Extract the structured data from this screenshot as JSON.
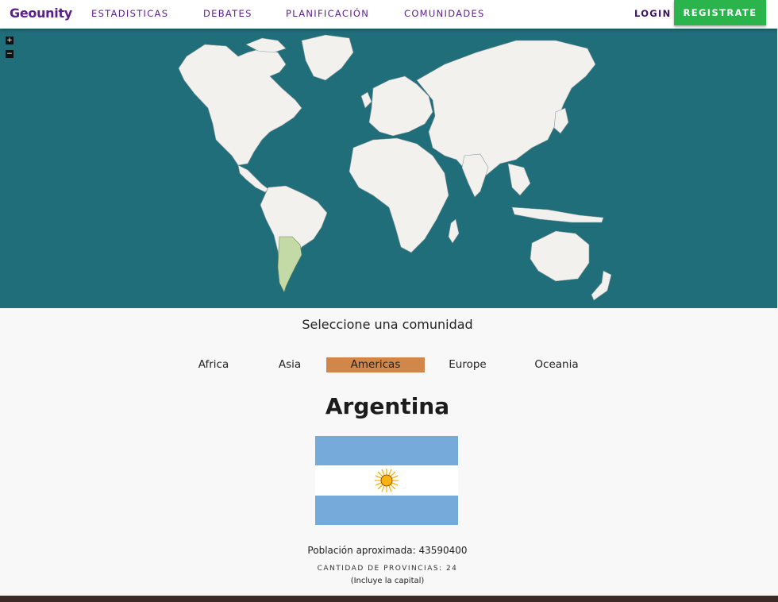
{
  "header": {
    "brand": "Geounity",
    "nav": [
      "ESTADISTICAS",
      "DEBATES",
      "PLANIFICACIÓN",
      "COMUNIDADES"
    ],
    "login": "LOGIN",
    "register": "REGISTRATE"
  },
  "map": {
    "zoom_in": "+",
    "zoom_out": "−",
    "ocean_color": "#216e7b",
    "land_color": "#f2f1ee",
    "highlight_color": "#c3d9a6",
    "highlighted_country": "Argentina"
  },
  "selector": {
    "title": "Seleccione una comunidad",
    "tabs": [
      "Africa",
      "Asia",
      "Americas",
      "Europe",
      "Oceania"
    ],
    "active": "Americas",
    "active_color": "#d2874a"
  },
  "country": {
    "name": "Argentina",
    "flag_colors": [
      "#75aadb",
      "#ffffff",
      "#75aadb"
    ],
    "sun_color": "#f6b40e",
    "population_text": "Población aproximada: 43590400",
    "provinces_text": "CANTIDAD DE PROVINCIAS: 24",
    "capital_note": "(Incluye la capital)"
  }
}
